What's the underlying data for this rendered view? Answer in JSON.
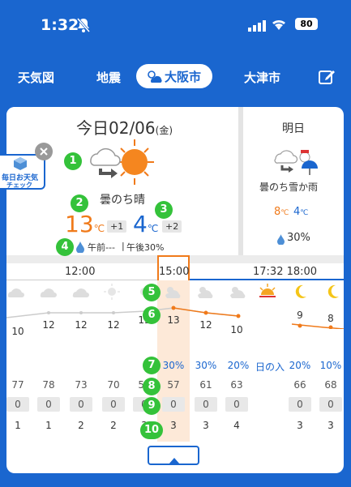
{
  "status": {
    "time": "1:32",
    "battery": "80"
  },
  "tabs": [
    {
      "label": "天気図"
    },
    {
      "label": "地震"
    },
    {
      "label": "大阪市"
    },
    {
      "label": "大津市"
    }
  ],
  "today": {
    "title": "今日02/06",
    "weekday": "(金)",
    "condition": "曇のち晴",
    "high": "13",
    "high_unit": "℃",
    "high_diff": "+1",
    "low": "4",
    "low_unit": "℃",
    "low_diff": "+2",
    "rain_am": "午前---",
    "rain_pm": "午後30%",
    "promo_line1": "毎日お天気",
    "promo_line2": "チェック"
  },
  "tomorrow": {
    "title": "明日",
    "condition": "曇のち雪か雨",
    "high": "8",
    "low": "4",
    "unit": "℃",
    "rain": "30%"
  },
  "timeline": {
    "labels": [
      "12:00",
      "15:00",
      "17:32 18:00"
    ],
    "temps": [
      "10",
      "12",
      "12",
      "12",
      "13",
      "13",
      "12",
      "10",
      "",
      "9",
      "8"
    ],
    "precip": [
      "",
      "",
      "",
      "",
      "",
      "30%",
      "30%",
      "20%",
      "日の入",
      "20%",
      "10%"
    ],
    "humidity": [
      "77",
      "78",
      "73",
      "70",
      "57",
      "57",
      "61",
      "63",
      "",
      "66",
      "68"
    ],
    "rain_mm": [
      "0",
      "0",
      "0",
      "0",
      "0",
      "0",
      "0",
      "0",
      "",
      "0",
      "0"
    ],
    "wind": [
      "1",
      "1",
      "2",
      "2",
      "3",
      "3",
      "3",
      "4",
      "",
      "3",
      "3"
    ]
  },
  "badges": [
    "1",
    "2",
    "3",
    "4",
    "5",
    "6",
    "7",
    "8",
    "9",
    "10"
  ],
  "colors": {
    "brand": "#1a66cf",
    "high": "#f07a1a",
    "low": "#1a66cf",
    "badge": "#34c23a"
  }
}
